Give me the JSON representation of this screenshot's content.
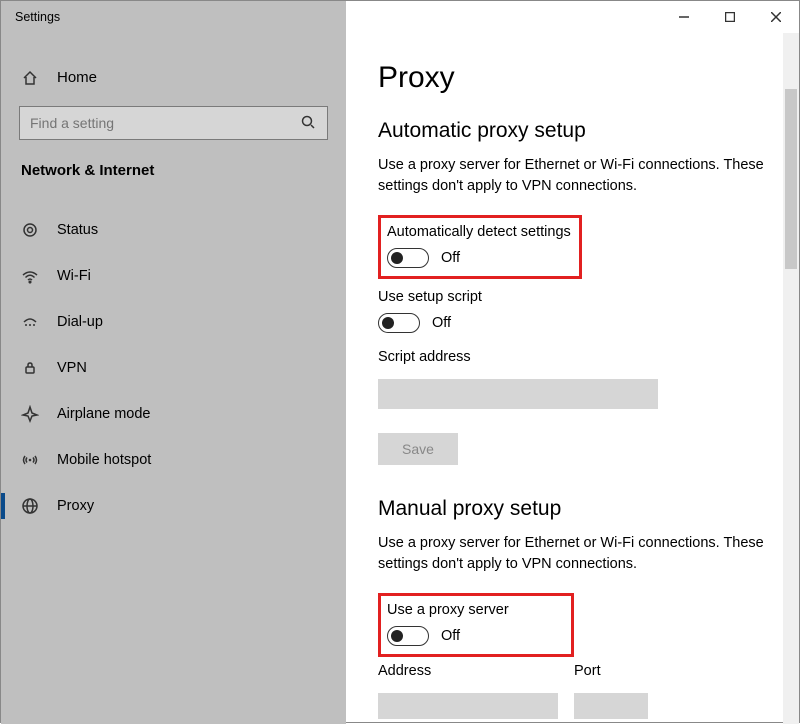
{
  "window": {
    "title": "Settings"
  },
  "sidebar": {
    "home_label": "Home",
    "search_placeholder": "Find a setting",
    "group_title": "Network & Internet",
    "items": [
      {
        "label": "Status"
      },
      {
        "label": "Wi-Fi"
      },
      {
        "label": "Dial-up"
      },
      {
        "label": "VPN"
      },
      {
        "label": "Airplane mode"
      },
      {
        "label": "Mobile hotspot"
      },
      {
        "label": "Proxy"
      }
    ]
  },
  "main": {
    "title": "Proxy",
    "auto": {
      "heading": "Automatic proxy setup",
      "desc": "Use a proxy server for Ethernet or Wi-Fi connections. These settings don't apply to VPN connections.",
      "detect_label": "Automatically detect settings",
      "detect_state": "Off",
      "script_label": "Use setup script",
      "script_state": "Off",
      "script_addr_label": "Script address",
      "save_label": "Save"
    },
    "manual": {
      "heading": "Manual proxy setup",
      "desc": "Use a proxy server for Ethernet or Wi-Fi connections. These settings don't apply to VPN connections.",
      "use_label": "Use a proxy server",
      "use_state": "Off",
      "addr_label": "Address",
      "port_label": "Port"
    }
  }
}
